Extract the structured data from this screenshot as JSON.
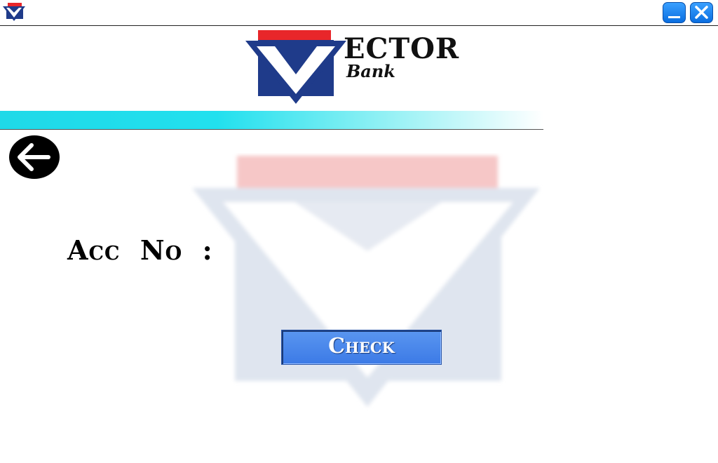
{
  "titlebar": {
    "icon": "vector-bank-logo-icon",
    "minimize_icon": "minimize-icon",
    "close_icon": "close-icon"
  },
  "header": {
    "brand_name": "ECTOR",
    "brand_sub": "Bank"
  },
  "form": {
    "account_label": "Acc  No  :"
  },
  "actions": {
    "check_label": "Check",
    "back_icon": "arrow-left-icon"
  },
  "colors": {
    "accent_red": "#e8262a",
    "navy": "#1f3b8a",
    "cyan_strip": "#1fd9e8",
    "button_blue": "#4a88ec"
  }
}
